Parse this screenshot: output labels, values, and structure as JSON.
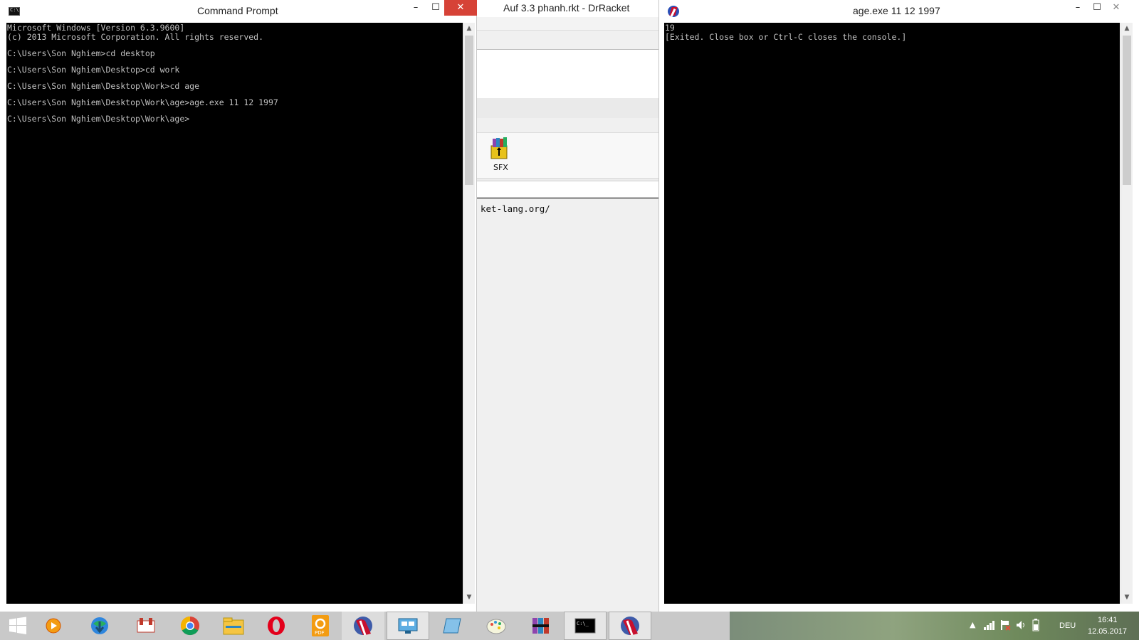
{
  "cmd_window": {
    "title": "Command Prompt",
    "minimize_glyph": "–",
    "maximize_glyph": "☐",
    "close_glyph": "✕",
    "console_lines": [
      "Microsoft Windows [Version 6.3.9600]",
      "(c) 2013 Microsoft Corporation. All rights reserved.",
      "",
      "C:\\Users\\Son Nghiem>cd desktop",
      "",
      "C:\\Users\\Son Nghiem\\Desktop>cd work",
      "",
      "C:\\Users\\Son Nghiem\\Desktop\\Work>cd age",
      "",
      "C:\\Users\\Son Nghiem\\Desktop\\Work\\age>age.exe 11 12 1997",
      "",
      "C:\\Users\\Son Nghiem\\Desktop\\Work\\age>"
    ]
  },
  "drracket_window": {
    "title": "Auf 3.3 phanh.rkt - DrRacket",
    "sfx_label": "SFX",
    "url_fragment": "ket-lang.org/"
  },
  "age_window": {
    "title": "age.exe  11 12 1997",
    "minimize_glyph": "–",
    "maximize_glyph": "☐",
    "close_glyph": "✕",
    "console_lines": [
      "19",
      "[Exited. Close box or Ctrl-C closes the console.]"
    ]
  },
  "taskbar": {
    "items": [
      {
        "name": "start-button-icon"
      },
      {
        "name": "media-player-icon"
      },
      {
        "name": "internet-download-manager-icon"
      },
      {
        "name": "ultraviewer-icon"
      },
      {
        "name": "chrome-icon"
      },
      {
        "name": "file-explorer-icon"
      },
      {
        "name": "opera-icon"
      },
      {
        "name": "foxit-pdf-icon"
      },
      {
        "name": "drracket-icon"
      },
      {
        "name": "remote-desktop-icon"
      },
      {
        "name": "notepad-icon"
      },
      {
        "name": "paint-icon"
      },
      {
        "name": "winrar-icon"
      },
      {
        "name": "command-prompt-icon"
      },
      {
        "name": "racket-console-icon"
      }
    ],
    "language": "DEU",
    "time": "16:41",
    "date": "12.05.2017"
  },
  "colors": {
    "console_bg": "#000000",
    "console_fg": "#c0c0c0",
    "close_red": "#d64237",
    "taskbar": "#c9c9c9"
  }
}
